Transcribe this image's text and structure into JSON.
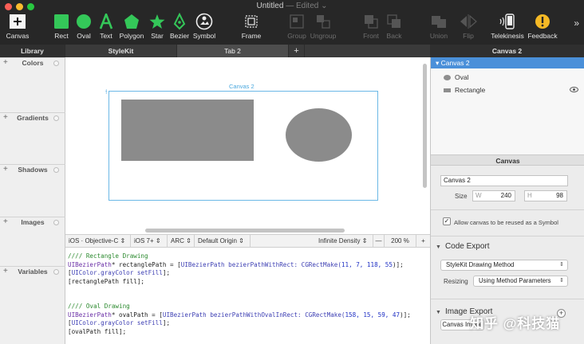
{
  "window": {
    "title": "Untitled",
    "status": "— Edited",
    "traffic_colors": {
      "close": "#fc5f57",
      "minimize": "#fdbb2e",
      "maximize": "#28c840"
    }
  },
  "toolbar": {
    "canvas": "Canvas",
    "rect": "Rect",
    "oval": "Oval",
    "text": "Text",
    "polygon": "Polygon",
    "star": "Star",
    "bezier": "Bezier",
    "symbol": "Symbol",
    "frame": "Frame",
    "group": "Group",
    "ungroup": "Ungroup",
    "front": "Front",
    "back": "Back",
    "union": "Union",
    "flip": "Flip",
    "telekinesis": "Telekinesis",
    "feedback": "Feedback",
    "more": "»",
    "accent_green": "#34c759"
  },
  "tabs": {
    "library": "Library",
    "stylekit": "StyleKit",
    "tab2": "Tab 2",
    "add": "+",
    "inspector_title": "Canvas 2"
  },
  "library": {
    "sections": [
      "Colors",
      "Gradients",
      "Shadows",
      "Images",
      "Variables"
    ],
    "plus": "+"
  },
  "canvas": {
    "label": "Canvas 2",
    "shape_color": "#8b8b8b",
    "frame_color": "#6bb8e6"
  },
  "codebar": {
    "language": "iOS · Objective-C",
    "ios_version": "iOS 7+",
    "arc": "ARC",
    "origin": "Default Origin",
    "density": "Infinite Density",
    "minus": "—",
    "zoom": "200 %",
    "plus": "+"
  },
  "code": {
    "rect_comment": "//// Rectangle Drawing",
    "rect_line1_type": "UIBezierPath",
    "rect_line1_var": "* rectanglePath = [",
    "rect_line1_call": "UIBezierPath bezierPathWithRect: CGRectMake(",
    "rect_line1_nums": "11, 7, 118, 55",
    "rect_line1_end": ")];",
    "rect_line2_a": "[",
    "rect_line2_b": "UIColor.grayColor setFill",
    "rect_line2_c": "];",
    "rect_line3": "[rectanglePath fill];",
    "oval_comment": "//// Oval Drawing",
    "oval_line1_type": "UIBezierPath",
    "oval_line1_var": "* ovalPath = [",
    "oval_line1_call": "UIBezierPath bezierPathWithOvalInRect: CGRectMake(",
    "oval_line1_nums": "158, 15, 59, 47",
    "oval_line1_end": ")];",
    "oval_line2_a": "[",
    "oval_line2_b": "UIColor.grayColor setFill",
    "oval_line2_c": "];",
    "oval_line3": "[ovalPath fill];"
  },
  "layers": {
    "selected": "Canvas 2",
    "items": [
      "Oval",
      "Rectangle"
    ],
    "selected_color": "#4a90d9"
  },
  "inspector": {
    "header": "Canvas",
    "name": "Canvas 2",
    "size_label": "Size",
    "w_prefix": "W",
    "w_value": "240",
    "h_prefix": "H",
    "h_value": "98",
    "reuse_checked": true,
    "reuse_check_glyph": "✓",
    "reuse_label": "Allow canvas to be reused as a Symbol",
    "code_export_title": "Code Export",
    "code_export_method": "StyleKit Drawing Method",
    "resizing_label": "Resizing",
    "resizing_value": "Using Method Parameters",
    "image_export_title": "Image Export",
    "image_add": "+",
    "canvas_image_button": "Canvas Image"
  },
  "watermark": "知乎 @科技猫"
}
